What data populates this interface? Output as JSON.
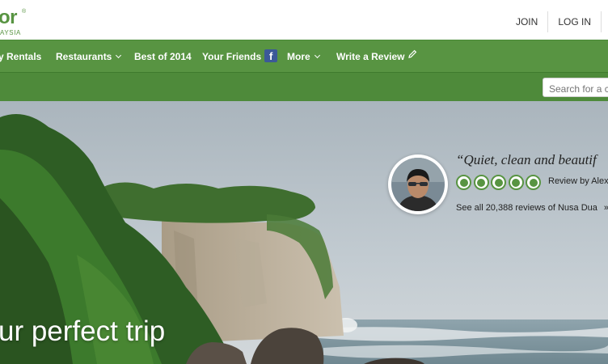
{
  "header": {
    "logo_text": "or",
    "logo_reg": "®",
    "logo_sub": "AYSIA",
    "join_label": "JOIN",
    "login_label": "LOG IN"
  },
  "nav": {
    "items": [
      {
        "label": "y Rentals"
      },
      {
        "label": "Restaurants"
      },
      {
        "label": "Best of 2014"
      },
      {
        "label": "Your Friends"
      },
      {
        "label": "More"
      },
      {
        "label": "Write a Review"
      }
    ],
    "facebook_glyph": "f"
  },
  "search": {
    "placeholder": "Search for a c"
  },
  "hero": {
    "title": "ur perfect trip",
    "review": {
      "quote": "“Quiet, clean and beautif",
      "rating": 5,
      "review_by": "Review by Alex",
      "see_all": "See all 20,388 reviews of Nusa Dua",
      "see_all_arrow": "»"
    }
  },
  "colors": {
    "brand_green": "#589442",
    "dark_green": "#4e8a3a",
    "facebook_blue": "#3b5998"
  },
  "icons": [
    "chevron-down-icon",
    "facebook-icon",
    "pencil-icon",
    "rating-bubble-icon"
  ]
}
